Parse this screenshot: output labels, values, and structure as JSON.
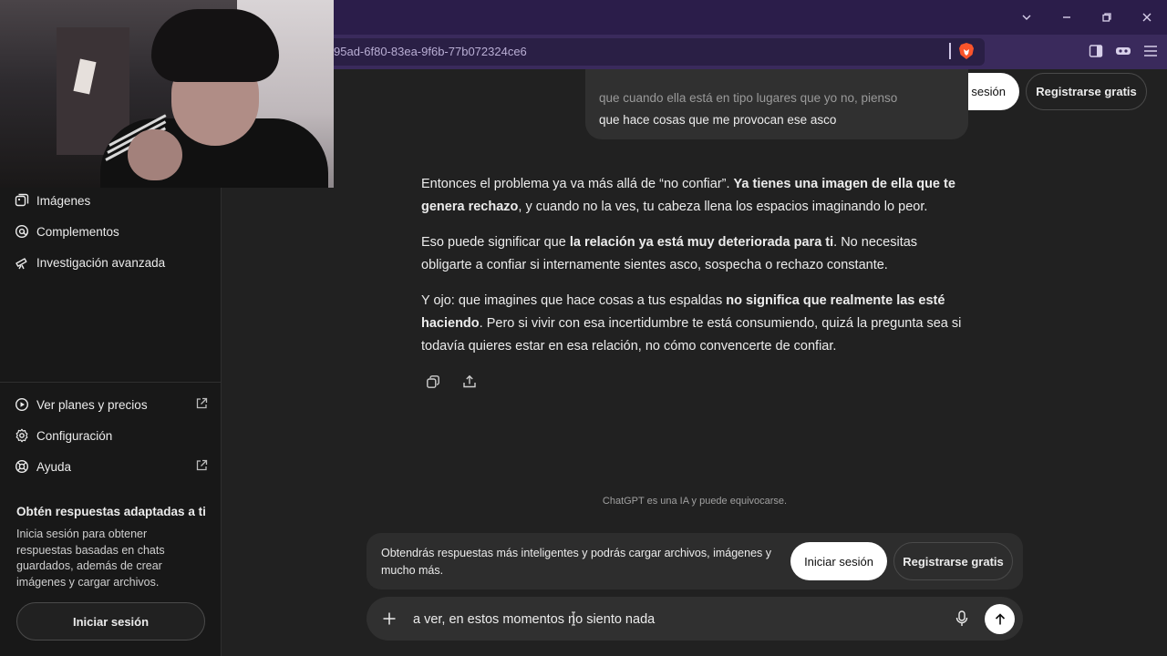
{
  "browser": {
    "url": "95ad-6f80-83ea-9f6b-77b072324ce6"
  },
  "sidebar": {
    "items_top": [
      {
        "label": "Imágenes",
        "icon": "images-icon"
      },
      {
        "label": "Complementos",
        "icon": "plugins-icon"
      },
      {
        "label": "Investigación avanzada",
        "icon": "telescope-icon"
      }
    ],
    "items_bottom": [
      {
        "label": "Ver planes y precios",
        "icon": "plans-icon",
        "external": true
      },
      {
        "label": "Configuración",
        "icon": "gear-icon",
        "external": false
      },
      {
        "label": "Ayuda",
        "icon": "help-icon",
        "external": true
      }
    ],
    "promo_title": "Obtén respuestas adaptadas a ti",
    "promo_text": "Inicia sesión para obtener respuestas basadas en chats guardados, además de crear imágenes y cargar archivos.",
    "login_label": "Iniciar sesión"
  },
  "header": {
    "login_label": "Iniciar sesión",
    "register_label": "Registrarse gratis"
  },
  "chat": {
    "user_message_line1": "que cuando ella está en tipo lugares que yo no, pienso",
    "user_message_line2": "que hace cosas que me provocan ese asco",
    "assistant_paragraphs": [
      [
        {
          "t": "Entonces el problema ya va más allá de “no confiar”. ",
          "b": false
        },
        {
          "t": "Ya tienes una imagen de ella que te genera rechazo",
          "b": true
        },
        {
          "t": ", y cuando no la ves, tu cabeza llena los espacios imaginando lo peor.",
          "b": false
        }
      ],
      [
        {
          "t": "Eso puede significar que ",
          "b": false
        },
        {
          "t": "la relación ya está muy deteriorada para ti",
          "b": true
        },
        {
          "t": ". No necesitas obligarte a confiar si internamente sientes asco, sospecha o rechazo constante.",
          "b": false
        }
      ],
      [
        {
          "t": "Y ojo: que imagines que hace cosas a tus espaldas ",
          "b": false
        },
        {
          "t": "no significa que realmente las esté haciendo",
          "b": true
        },
        {
          "t": ". Pero si vivir con esa incertidumbre te está consumiendo, quizá la pregunta sea si todavía quieres estar en esa relación, no cómo convencerte de confiar.",
          "b": false
        }
      ]
    ],
    "disclaimer": "ChatGPT es una IA y puede equivocarse."
  },
  "promo_panel": {
    "text": "Obtendrás respuestas más inteligentes y podrás cargar archivos, imágenes y mucho más.",
    "login_label": "Iniciar sesión",
    "register_label": "Registrarse gratis"
  },
  "composer": {
    "value": "a ver, en estos momentos no siento nada"
  },
  "colors": {
    "background": "#212121",
    "sidebar": "#181818",
    "browser_frame": "#3a2a5c",
    "brave_orange": "#fb542b"
  }
}
